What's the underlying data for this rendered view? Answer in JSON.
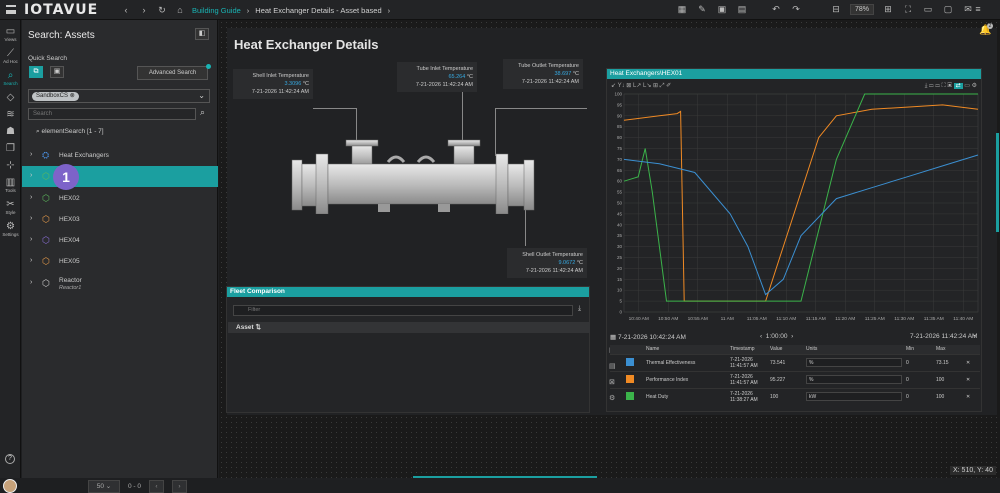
{
  "app": {
    "logo": "IOTAVUE"
  },
  "breadcrumb": {
    "items": [
      "Building Guide",
      "Heat Exchanger Details - Asset based"
    ]
  },
  "toolbar": {
    "zoom": "78%"
  },
  "leftnav": {
    "items": [
      {
        "label": "Views",
        "icon": "views-icon"
      },
      {
        "label": "Ad Hoc",
        "icon": "adhoc-icon"
      },
      {
        "label": "Search",
        "icon": "search-icon"
      },
      {
        "label": "Tools",
        "icon": "tools-icon"
      },
      {
        "label": "Style",
        "icon": "style-icon"
      },
      {
        "label": "Settings",
        "icon": "settings-icon"
      }
    ]
  },
  "panel": {
    "title": "Search: Assets",
    "quick_search_label": "Quick Search",
    "advanced_search": "Advanced Search",
    "chip": "SandboxCS",
    "search_placeholder": "Search",
    "element_search": "elementSearch [1 - 7]",
    "tree": [
      {
        "label": "Heat Exchangers",
        "sub": "",
        "color": "#4a90e2"
      },
      {
        "label": "",
        "sub": "",
        "color": "#5cb85c",
        "selected": true
      },
      {
        "label": "HEX02",
        "sub": "",
        "color": "#5cb85c"
      },
      {
        "label": "HEX03",
        "sub": "",
        "color": "#e69a4a"
      },
      {
        "label": "HEX04",
        "sub": "",
        "color": "#8a6fd6"
      },
      {
        "label": "HEX05",
        "sub": "",
        "color": "#e69a4a"
      },
      {
        "label": "Reactor",
        "sub": "Reactor1",
        "color": "#cccccc"
      }
    ],
    "badge": "1",
    "pager": {
      "page_size": "50",
      "range": "0 - 0"
    }
  },
  "dashboard": {
    "title": "Heat Exchanger Details",
    "readouts": {
      "shell_inlet": {
        "label": "Shell Inlet Temperature",
        "value": "3.3096",
        "unit": "°C",
        "time": "7-21-2026 11:42:24 AM"
      },
      "tube_inlet": {
        "label": "Tube Inlet Temperature",
        "value": "65.264",
        "unit": "°C",
        "time": "7-21-2026 11:42:24 AM"
      },
      "tube_outlet": {
        "label": "Tube Outlet Temperature",
        "value": "38.697",
        "unit": "°C",
        "time": "7-21-2026 11:42:24 AM"
      },
      "shell_outlet": {
        "label": "Shell Outlet Temperature",
        "value": "9.0672",
        "unit": "°C",
        "time": "7-21-2026 11:42:24 AM"
      }
    },
    "trend_title": "Heat Exchangers\\HEX01",
    "trend_start": "7-21-2026 10:42:24 AM",
    "trend_end": "7-21-2026 11:42:24 AM",
    "trend_span": "1:00:00",
    "table_headers": [
      "Name",
      "Timestamp",
      "Value",
      "Units",
      "Min",
      "Max"
    ],
    "table_rows": [
      {
        "name": "Thermal Effectiveness",
        "ts": "7-21-2026 11:41:57 AM",
        "value": "73.541",
        "unit": "%",
        "min": "0",
        "max": "73.15",
        "color": "#3b8fd1"
      },
      {
        "name": "Performance Index",
        "ts": "7-21-2026 11:41:57 AM",
        "value": "95.227",
        "unit": "%",
        "min": "0",
        "max": "100",
        "color": "#f08a24"
      },
      {
        "name": "Heat Duty",
        "ts": "7-21-2026 11:38:27 AM",
        "value": "100",
        "unit": "kW",
        "min": "0",
        "max": "100",
        "color": "#3bb34a"
      }
    ],
    "fleet_title": "Fleet Comparison",
    "fleet_filter": "Filter",
    "fleet_col": "Asset"
  },
  "coords": "X: 510, Y: 40",
  "notif_count": "2",
  "chart_data": {
    "type": "line",
    "title": "",
    "x": [
      "10:40 AM",
      "10:50 AM",
      "10:55 AM",
      "11 AM",
      "11:05 AM",
      "11:10 AM",
      "11:15 AM",
      "11:20 AM",
      "11:25 AM",
      "11:30 AM",
      "11:35 AM",
      "11:40 AM"
    ],
    "ylim": [
      0,
      100
    ],
    "yticks": [
      0,
      5,
      10,
      15,
      20,
      25,
      30,
      35,
      40,
      45,
      50,
      55,
      60,
      65,
      70,
      75,
      80,
      85,
      90,
      95,
      100
    ],
    "series": [
      {
        "color": "#f08a24",
        "points": [
          [
            0,
            88
          ],
          [
            0.1,
            90
          ],
          [
            0.15,
            91
          ],
          [
            0.16,
            92
          ],
          [
            0.17,
            5
          ],
          [
            0.4,
            5
          ],
          [
            0.45,
            30
          ],
          [
            0.5,
            55
          ],
          [
            0.55,
            80
          ],
          [
            0.6,
            90
          ],
          [
            0.7,
            93
          ],
          [
            0.8,
            94
          ],
          [
            0.9,
            95
          ],
          [
            1,
            93
          ]
        ]
      },
      {
        "color": "#3bb34a",
        "points": [
          [
            0,
            60
          ],
          [
            0.04,
            62
          ],
          [
            0.06,
            75
          ],
          [
            0.08,
            55
          ],
          [
            0.12,
            5
          ],
          [
            0.2,
            5
          ],
          [
            0.5,
            5
          ],
          [
            0.6,
            70
          ],
          [
            0.68,
            100
          ],
          [
            1,
            100
          ]
        ]
      },
      {
        "color": "#3b8fd1",
        "points": [
          [
            0,
            70
          ],
          [
            0.1,
            68
          ],
          [
            0.2,
            64
          ],
          [
            0.3,
            45
          ],
          [
            0.35,
            30
          ],
          [
            0.4,
            8
          ],
          [
            0.45,
            15
          ],
          [
            0.5,
            35
          ],
          [
            0.6,
            52
          ],
          [
            0.7,
            57
          ],
          [
            0.8,
            62
          ],
          [
            0.9,
            67
          ],
          [
            1,
            72
          ]
        ]
      }
    ]
  }
}
